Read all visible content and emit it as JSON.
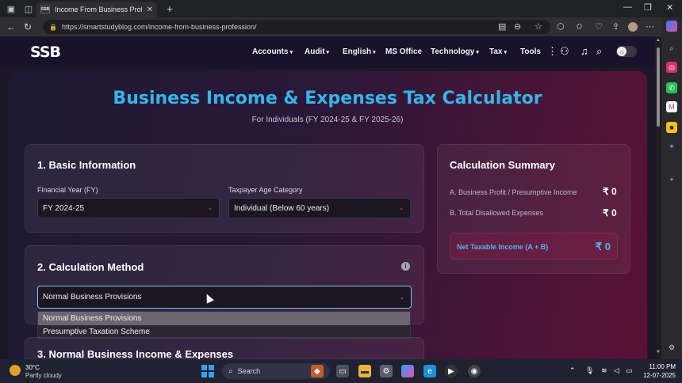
{
  "browser": {
    "tab_title": "Income From Business Professio",
    "tab_favicon": "SSB",
    "url": "https://smartstudyblog.com/income-from-business-profession/"
  },
  "site": {
    "logo": "SSB",
    "menu": [
      {
        "label": "Accounts",
        "has_dropdown": true
      },
      {
        "label": "Audit",
        "has_dropdown": true
      },
      {
        "label": "English",
        "has_dropdown": true
      },
      {
        "label": "MS Office",
        "has_dropdown": false
      },
      {
        "label": "Technology",
        "has_dropdown": true
      },
      {
        "label": "Tax",
        "has_dropdown": true
      },
      {
        "label": "Tools",
        "has_dropdown": false
      }
    ]
  },
  "calculator": {
    "title": "Business Income & Expenses Tax Calculator",
    "subtitle": "For Individuals (FY 2024-25 & FY 2025-26)",
    "basic_info": {
      "heading": "1. Basic Information",
      "fy_label": "Financial Year (FY)",
      "fy_value": "FY 2024-25",
      "age_label": "Taxpayer Age Category",
      "age_value": "Individual (Below 60 years)"
    },
    "method": {
      "heading": "2. Calculation Method",
      "selected": "Normal Business Provisions",
      "options": [
        "Normal Business Provisions",
        "Presumptive Taxation Scheme"
      ]
    },
    "section3_heading": "3. Normal Business Income & Expenses",
    "summary": {
      "heading": "Calculation Summary",
      "row_a_label": "A. Business Profit / Presumptive Income",
      "row_a_value": "₹ 0",
      "row_b_label": "B. Total Disallowed Expenses",
      "row_b_value": "₹ 0",
      "net_label": "Net Taxable Income (A + B)",
      "net_value": "₹ 0"
    }
  },
  "taskbar": {
    "temperature": "30°C",
    "weather": "Partly cloudy",
    "search_label": "Search",
    "time": "11:00 PM",
    "date": "12-07-2025"
  },
  "colors": {
    "accent": "#33b6ea",
    "logo_orange": "#f28a1e"
  }
}
